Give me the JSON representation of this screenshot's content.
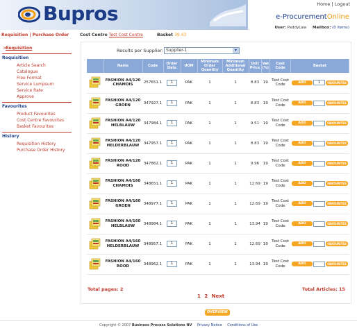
{
  "header": {
    "logo_text": "Bupros",
    "top_links": [
      "Home",
      "Logout"
    ],
    "product_name": "e-Procurement",
    "product_suffix": "Online",
    "user_label": "User:",
    "user_value": "PaddyLaw",
    "mailbox_label": "Mailbox:",
    "mailbox_value": "(0 items)"
  },
  "subbar": {
    "breadcrumb": "Requisition | Purchase Order",
    "cost_centre_label": "Cost Centre",
    "cost_centre_value": "Test Cost Centre",
    "basket_label": "Basket",
    "basket_value": "39.43"
  },
  "sidebar": {
    "active": "Requisition",
    "sections": [
      {
        "title": "Requisition",
        "items": [
          "Article Search",
          "Catalogue",
          "Free Format",
          "Service Lumpsum",
          "Service Rate",
          "Approve"
        ]
      },
      {
        "title": "Favourites",
        "items": [
          "Product Favourites",
          "Cost Centre Favourites",
          "Basket Favourites"
        ]
      },
      {
        "title": "History",
        "items": [
          "Requisition History",
          "Purchase Order History"
        ]
      }
    ]
  },
  "filter": {
    "label": "Results per Supplier:",
    "selected": "Supplier-1"
  },
  "table": {
    "headers": [
      "",
      "Name",
      "Code",
      "Order Data",
      "UOM",
      "Minimum Order Quantity",
      "Minimum Additional Quantity",
      "Unit Price",
      "Vat (%)",
      "Cost Code",
      "Basket"
    ],
    "rows": [
      {
        "name": "FASHION A4/120 CHAMOIS",
        "code": "257651.1",
        "order": "1",
        "uom": "PAK",
        "min_order": "1",
        "min_add": "1",
        "price": "8.83",
        "vat": "19",
        "cost_code": "Test Cost Code",
        "basket_qty": "1"
      },
      {
        "name": "FASHION A4/120 GROEN",
        "code": "347927.1",
        "order": "1",
        "uom": "PAK",
        "min_order": "1",
        "min_add": "1",
        "price": "8.83",
        "vat": "19",
        "cost_code": "Test Cost Code",
        "basket_qty": ""
      },
      {
        "name": "FASHION A4/120 HELBLAUW",
        "code": "347984.1",
        "order": "1",
        "uom": "PAK",
        "min_order": "1",
        "min_add": "1",
        "price": "9.51",
        "vat": "19",
        "cost_code": "Test Cost Code",
        "basket_qty": ""
      },
      {
        "name": "FASHION A4/120 HELDERBLAUW",
        "code": "347957.1",
        "order": "1",
        "uom": "PAK",
        "min_order": "1",
        "min_add": "1",
        "price": "8.83",
        "vat": "19",
        "cost_code": "Test Cost Code",
        "basket_qty": ""
      },
      {
        "name": "FASHION A4/120 ROOD",
        "code": "347862.1",
        "order": "1",
        "uom": "PAK",
        "min_order": "1",
        "min_add": "1",
        "price": "9.96",
        "vat": "19",
        "cost_code": "Test Cost Code",
        "basket_qty": ""
      },
      {
        "name": "FASHION A4/160 CHAMOIS",
        "code": "348651.1",
        "order": "1",
        "uom": "PAK",
        "min_order": "1",
        "min_add": "1",
        "price": "12.69",
        "vat": "19",
        "cost_code": "Test Cost Code",
        "basket_qty": ""
      },
      {
        "name": "FASHION A4/160 GROEN",
        "code": "348977.1",
        "order": "1",
        "uom": "PAK",
        "min_order": "1",
        "min_add": "1",
        "price": "12.69",
        "vat": "19",
        "cost_code": "Test Cost Code",
        "basket_qty": ""
      },
      {
        "name": "FASHION A4/160 HELBLAUW",
        "code": "348984.1",
        "order": "1",
        "uom": "PAK",
        "min_order": "1",
        "min_add": "1",
        "price": "13.94",
        "vat": "19",
        "cost_code": "Test Cost Code",
        "basket_qty": ""
      },
      {
        "name": "FASHION A4/160 HELDERBLAUW",
        "code": "348957.1",
        "order": "1",
        "uom": "PAK",
        "min_order": "1",
        "min_add": "1",
        "price": "12.69",
        "vat": "19",
        "cost_code": "Test Cost Code",
        "basket_qty": ""
      },
      {
        "name": "FASHION A4/160 ROOD",
        "code": "348962.1",
        "order": "1",
        "uom": "PAK",
        "min_order": "1",
        "min_add": "1",
        "price": "13.94",
        "vat": "19",
        "cost_code": "Test Cost Code",
        "basket_qty": ""
      }
    ],
    "add_label": "ADD",
    "fav_label": "FAVOURITES"
  },
  "pagination": {
    "total_pages": "Total pages: 2",
    "total_articles": "Total Articles: 15",
    "pages": [
      "1",
      "2"
    ],
    "next": "Next"
  },
  "overview_label": "OVERVIEW",
  "footer": {
    "copyright": "Copyright © 2007",
    "company": "Business Process Solutions NV",
    "links": [
      "Privacy Notice",
      "Conditions of Use"
    ]
  },
  "colors": {
    "accent": "#f5a623",
    "brand": "#1b3b86",
    "link": "#c0392b",
    "header_row": "#8aa9d8"
  }
}
